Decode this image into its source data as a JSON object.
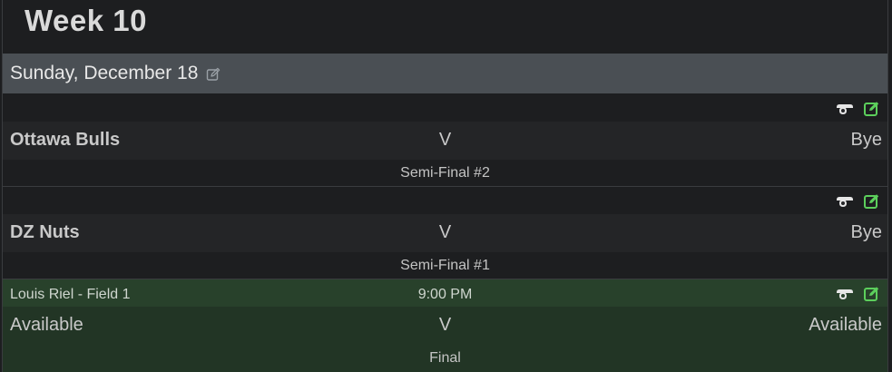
{
  "week": {
    "title": "Week 10"
  },
  "day": {
    "label": "Sunday, December 18"
  },
  "games": [
    {
      "location": "",
      "time": "",
      "home": "Ottawa Bulls",
      "vs": "V",
      "away": "Bye",
      "name": "Semi-Final #2"
    },
    {
      "location": "",
      "time": "",
      "home": "DZ Nuts",
      "vs": "V",
      "away": "Bye",
      "name": "Semi-Final #1"
    },
    {
      "location": "Louis Riel - Field 1",
      "time": "9:00 PM",
      "home": "Available",
      "vs": "V",
      "away": "Available",
      "name": "Final"
    }
  ],
  "icons": {
    "view": "whistle-icon",
    "edit": "edit-icon"
  },
  "colors": {
    "edit_icon": "#5ccf5c",
    "selected_row": "#28412b"
  }
}
